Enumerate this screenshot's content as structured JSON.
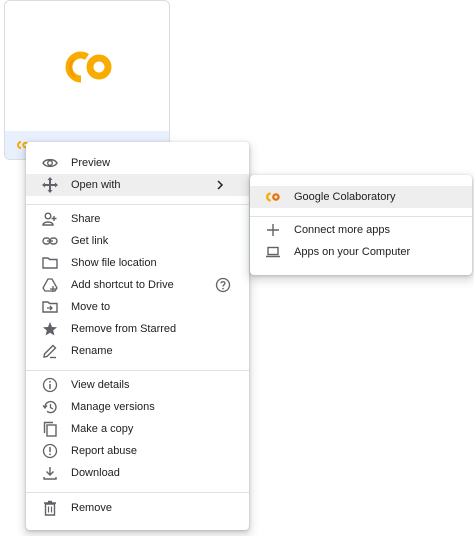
{
  "colors": {
    "colab_yellow": "#f9ab00",
    "colab_orange": "#ffc107",
    "icon_gray": "#5f6368",
    "hover_gray": "#eeeeee"
  },
  "file_card": {
    "thumbnail_icon": "colab-logo-icon",
    "footer_icon": "colab-logo-icon"
  },
  "context_menu": {
    "items": [
      {
        "label": "Preview",
        "icon": "eye-icon"
      },
      {
        "label": "Open with",
        "icon": "move-arrows-icon"
      },
      {
        "label": "Share",
        "icon": "person-add-icon"
      },
      {
        "label": "Get link",
        "icon": "link-icon"
      },
      {
        "label": "Show file location",
        "icon": "folder-icon"
      },
      {
        "label": "Add shortcut to Drive",
        "icon": "add-shortcut-icon"
      },
      {
        "label": "Move to",
        "icon": "move-to-folder-icon"
      },
      {
        "label": "Remove from Starred",
        "icon": "star-icon"
      },
      {
        "label": "Rename",
        "icon": "pencil-icon"
      },
      {
        "label": "View details",
        "icon": "info-icon"
      },
      {
        "label": "Manage versions",
        "icon": "history-icon"
      },
      {
        "label": "Make a copy",
        "icon": "copy-icon"
      },
      {
        "label": "Report abuse",
        "icon": "alert-icon"
      },
      {
        "label": "Download",
        "icon": "download-icon"
      },
      {
        "label": "Remove",
        "icon": "trash-icon"
      }
    ]
  },
  "submenu": {
    "items": [
      {
        "label": "Google Colaboratory",
        "icon": "colab-logo-icon"
      },
      {
        "label": "Connect more apps",
        "icon": "plus-icon"
      },
      {
        "label": "Apps on your Computer",
        "icon": "laptop-icon"
      }
    ]
  }
}
